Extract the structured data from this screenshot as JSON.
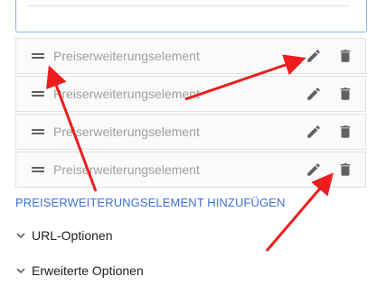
{
  "items": [
    {
      "label": "Preiserweiterungselement"
    },
    {
      "label": "Preiserweiterungselement"
    },
    {
      "label": "Preiserweiterungselement"
    },
    {
      "label": "Preiserweiterungselement"
    }
  ],
  "add_button_label": "PREISERWEITERUNGSELEMENT HINZUFÜGEN",
  "sections": [
    {
      "label": "URL-Optionen"
    },
    {
      "label": "Erweiterte Optionen"
    }
  ],
  "icons": {
    "drag": "drag-handle-icon",
    "edit": "pencil-icon",
    "delete": "trash-icon",
    "expand": "chevron-down-icon"
  },
  "colors": {
    "accent": "#3c6fd8",
    "annotation_arrow": "#ee1c1c",
    "icon": "#616161",
    "placeholder_text": "#9e9e9e"
  }
}
